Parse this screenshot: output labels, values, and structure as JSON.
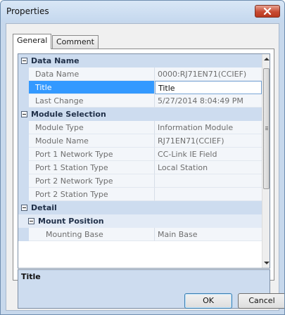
{
  "window": {
    "title": "Properties",
    "close_icon": "close-icon"
  },
  "tabs": [
    {
      "label": "General",
      "active": true
    },
    {
      "label": "Comment",
      "active": false
    }
  ],
  "grid": {
    "categories": [
      {
        "label": "Data Name",
        "properties": [
          {
            "name": "Data Name",
            "value": "0000:RJ71EN71(CCIEF)"
          },
          {
            "name": "Title",
            "value": "Title",
            "selected": true
          },
          {
            "name": "Last Change",
            "value": "5/27/2014 8:04:49 PM"
          }
        ]
      },
      {
        "label": "Module Selection",
        "properties": [
          {
            "name": "Module Type",
            "value": "Information Module"
          },
          {
            "name": "Module Name",
            "value": "RJ71EN71(CCIEF)"
          },
          {
            "name": "Port 1 Network Type",
            "value": "CC-Link IE Field"
          },
          {
            "name": "Port 1 Station Type",
            "value": "Local Station"
          },
          {
            "name": "Port 2 Network Type",
            "value": ""
          },
          {
            "name": "Port 2 Station Type",
            "value": ""
          }
        ]
      },
      {
        "label": "Detail",
        "subcategory": {
          "label": "Mount Position",
          "properties": [
            {
              "name": "Mounting Base",
              "value": "Main Base"
            }
          ]
        }
      }
    ]
  },
  "description": {
    "title": "Title"
  },
  "buttons": {
    "ok": "OK",
    "cancel": "Cancel"
  },
  "colors": {
    "category_bg": "#cddcef",
    "selection": "#3399ff",
    "close_button": "#c74a32"
  }
}
